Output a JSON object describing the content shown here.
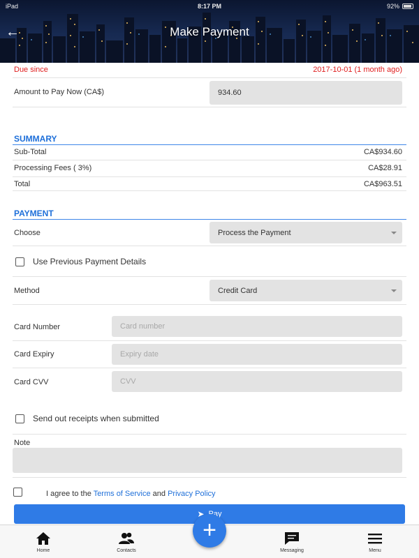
{
  "status_bar": {
    "carrier": "iPad",
    "time": "8:17 PM",
    "battery": "92%"
  },
  "header": {
    "title": "Make Payment",
    "back_icon": "arrow-left-icon"
  },
  "due": {
    "label": "Due since",
    "value": "2017-10-01 (1 month ago)",
    "color": "#e02020"
  },
  "amount": {
    "label": "Amount to Pay Now (CA$)",
    "value": "934.60"
  },
  "summary": {
    "title": "SUMMARY",
    "rows": [
      {
        "label": "Sub-Total",
        "value": "CA$934.60"
      },
      {
        "label": "Processing Fees ( 3%)",
        "value": "CA$28.91"
      },
      {
        "label": "Total",
        "value": "CA$963.51"
      }
    ]
  },
  "payment": {
    "title": "PAYMENT",
    "choose_label": "Choose",
    "choose_value": "Process the Payment",
    "use_previous_label": "Use Previous Payment Details",
    "method_label": "Method",
    "method_value": "Credit Card",
    "card_number_label": "Card Number",
    "card_number_placeholder": "Card number",
    "card_expiry_label": "Card Expiry",
    "card_expiry_placeholder": "Expiry date",
    "card_cvv_label": "Card CVV",
    "card_cvv_placeholder": "CVV"
  },
  "receipts_label": "Send out receipts when submitted",
  "note_label": "Note",
  "agree": {
    "prefix": "I agree to the ",
    "terms": "Terms of Service",
    "and": " and ",
    "privacy": "Privacy Policy"
  },
  "pay_button": "Pay",
  "tabbar": {
    "items": [
      {
        "label": "Home",
        "icon": "home-icon"
      },
      {
        "label": "Contacts",
        "icon": "contacts-icon"
      },
      {
        "label": "Messaging",
        "icon": "messaging-icon"
      },
      {
        "label": "Menu",
        "icon": "menu-icon"
      }
    ],
    "fab_icon": "plus-icon"
  },
  "colors": {
    "accent": "#2f7be6",
    "section": "#1e6fd9",
    "due": "#e02020",
    "field": "#e3e3e3"
  }
}
